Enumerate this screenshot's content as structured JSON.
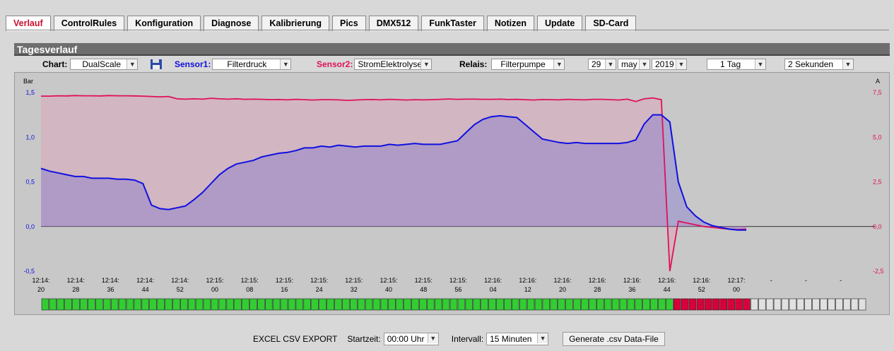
{
  "tabs": [
    "Verlauf",
    "ControlRules",
    "Konfiguration",
    "Diagnose",
    "Kalibrierung",
    "Pics",
    "DMX512",
    "FunkTaster",
    "Notizen",
    "Update",
    "SD-Card"
  ],
  "panel_title": "Tagesverlauf",
  "controls": {
    "chart_label": "Chart:",
    "chart_value": "DualScale",
    "sensor1_label": "Sensor1:",
    "sensor1_value": "Filterdruck",
    "sensor2_label": "Sensor2:",
    "sensor2_value": "StromElektrolyse",
    "relais_label": "Relais:",
    "relais_value": "Filterpumpe",
    "day": "29",
    "month": "may",
    "year": "2019",
    "range": "1 Tag",
    "interval": "2 Sekunden"
  },
  "bottom": {
    "export_label": "EXCEL CSV EXPORT",
    "startzeit_label": "Startzeit:",
    "startzeit_value": "00:00 Uhr",
    "intervall_label": "Intervall:",
    "intervall_value": "15 Minuten",
    "generate_label": "Generate .csv Data-File"
  },
  "colors": {
    "sensor1": "#1010e0",
    "sensor2": "#e0105a",
    "active_tab": "#c8102e",
    "relais_on": "#33cc33",
    "relais_off": "#d8003a",
    "relais_none": "#e0e0e0"
  },
  "chart_data": {
    "type": "line",
    "left_axis": {
      "label": "Bar",
      "ylim": [
        -0.5,
        1.5
      ],
      "ticks": [
        "-0,5",
        "0,0",
        "0,5",
        "1,0",
        "1,5"
      ]
    },
    "right_axis": {
      "label": "A",
      "ylim": [
        -2.5,
        7.5
      ],
      "ticks": [
        "-2,5",
        "0,0",
        "2,5",
        "5,0",
        "7,5"
      ]
    },
    "x_ticks": [
      [
        "12:14:",
        "20"
      ],
      [
        "12:14:",
        "28"
      ],
      [
        "12:14:",
        "36"
      ],
      [
        "12:14:",
        "44"
      ],
      [
        "12:14:",
        "52"
      ],
      [
        "12:15:",
        "00"
      ],
      [
        "12:15:",
        "08"
      ],
      [
        "12:15:",
        "16"
      ],
      [
        "12:15:",
        "24"
      ],
      [
        "12:15:",
        "32"
      ],
      [
        "12:15:",
        "40"
      ],
      [
        "12:15:",
        "48"
      ],
      [
        "12:15:",
        "56"
      ],
      [
        "12:16:",
        "04"
      ],
      [
        "12:16:",
        "12"
      ],
      [
        "12:16:",
        "20"
      ],
      [
        "12:16:",
        "28"
      ],
      [
        "12:16:",
        "36"
      ],
      [
        "12:16:",
        "44"
      ],
      [
        "12:16:",
        "52"
      ],
      [
        "12:17:",
        "00"
      ],
      [
        "-",
        ""
      ],
      [
        "-",
        ""
      ],
      [
        "-",
        ""
      ]
    ],
    "series": [
      {
        "axis": "left",
        "values": [
          0.65,
          0.62,
          0.6,
          0.58,
          0.56,
          0.56,
          0.54,
          0.54,
          0.54,
          0.53,
          0.53,
          0.52,
          0.48,
          0.24,
          0.2,
          0.19,
          0.21,
          0.23,
          0.3,
          0.38,
          0.48,
          0.58,
          0.65,
          0.7,
          0.72,
          0.74,
          0.78,
          0.8,
          0.82,
          0.83,
          0.85,
          0.88,
          0.88,
          0.9,
          0.89,
          0.91,
          0.9,
          0.89,
          0.9,
          0.9,
          0.9,
          0.92,
          0.91,
          0.92,
          0.93,
          0.92,
          0.92,
          0.92,
          0.94,
          0.96,
          1.05,
          1.14,
          1.2,
          1.23,
          1.24,
          1.23,
          1.22,
          1.14,
          1.06,
          0.98,
          0.96,
          0.94,
          0.93,
          0.94,
          0.93,
          0.93,
          0.93,
          0.93,
          0.93,
          0.94,
          0.97,
          1.15,
          1.25,
          1.25,
          1.17,
          0.5,
          0.22,
          0.12,
          0.05,
          0.01,
          -0.01,
          -0.03,
          -0.04,
          -0.04
        ]
      },
      {
        "axis": "right",
        "values": [
          7.3,
          7.3,
          7.32,
          7.31,
          7.33,
          7.32,
          7.32,
          7.31,
          7.33,
          7.32,
          7.32,
          7.31,
          7.3,
          7.28,
          7.26,
          7.28,
          7.15,
          7.13,
          7.15,
          7.13,
          7.18,
          7.15,
          7.13,
          7.15,
          7.12,
          7.13,
          7.12,
          7.1,
          7.11,
          7.09,
          7.12,
          7.1,
          7.08,
          7.1,
          7.1,
          7.09,
          7.06,
          7.08,
          7.1,
          7.11,
          7.09,
          7.12,
          7.1,
          7.08,
          7.1,
          7.09,
          7.1,
          7.12,
          7.14,
          7.12,
          7.13,
          7.13,
          7.12,
          7.12,
          7.13,
          7.11,
          7.12,
          7.1,
          7.08,
          7.11,
          7.1,
          7.09,
          7.12,
          7.1,
          7.09,
          7.12,
          7.12,
          7.1,
          7.08,
          7.13,
          7.0,
          7.15,
          7.2,
          7.1,
          -2.5,
          0.3,
          0.2,
          0.1,
          0.0,
          -0.05,
          -0.1,
          -0.15,
          -0.17,
          -0.15
        ]
      }
    ],
    "relais": {
      "on": 82,
      "off": 10,
      "none": 15
    }
  }
}
